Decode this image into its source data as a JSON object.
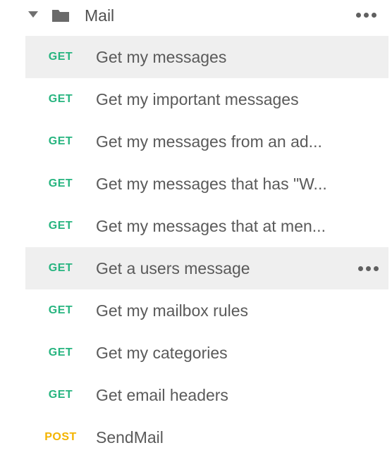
{
  "folder": {
    "title": "Mail",
    "icon": "folder-icon",
    "expand_icon": "caret-down-icon"
  },
  "colors": {
    "get": "#26b47f",
    "post": "#f4b400",
    "active_row": "#efefef",
    "text": "#5a5a5a"
  },
  "requests": [
    {
      "method": "GET",
      "name": "Get my messages"
    },
    {
      "method": "GET",
      "name": "Get my important messages"
    },
    {
      "method": "GET",
      "name": "Get my messages from an ad..."
    },
    {
      "method": "GET",
      "name": "Get my messages that has \"W..."
    },
    {
      "method": "GET",
      "name": "Get my messages that at men..."
    },
    {
      "method": "GET",
      "name": "Get a users message"
    },
    {
      "method": "GET",
      "name": "Get my mailbox rules"
    },
    {
      "method": "GET",
      "name": "Get my categories"
    },
    {
      "method": "GET",
      "name": "Get email headers"
    },
    {
      "method": "POST",
      "name": "SendMail"
    }
  ]
}
